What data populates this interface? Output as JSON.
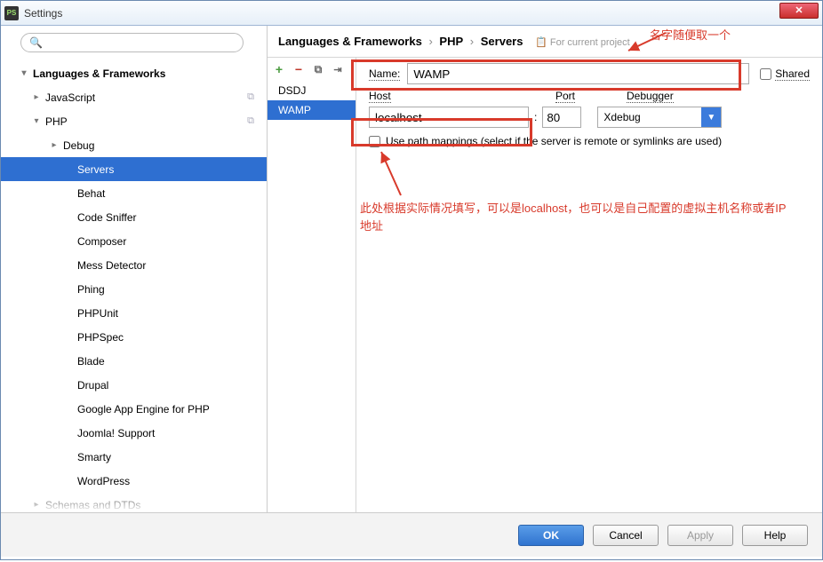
{
  "window": {
    "title": "Settings"
  },
  "search": {
    "placeholder": ""
  },
  "tree": {
    "root": "Languages & Frameworks",
    "items": [
      {
        "label": "JavaScript",
        "level": 1,
        "arrow": "▸",
        "copy": true
      },
      {
        "label": "PHP",
        "level": 1,
        "arrow": "▾",
        "copy": true
      },
      {
        "label": "Debug",
        "level": 2,
        "arrow": "▸"
      },
      {
        "label": "Servers",
        "level": 3,
        "selected": true
      },
      {
        "label": "Behat",
        "level": 3
      },
      {
        "label": "Code Sniffer",
        "level": 3
      },
      {
        "label": "Composer",
        "level": 3
      },
      {
        "label": "Mess Detector",
        "level": 3
      },
      {
        "label": "Phing",
        "level": 3
      },
      {
        "label": "PHPUnit",
        "level": 3
      },
      {
        "label": "PHPSpec",
        "level": 3
      },
      {
        "label": "Blade",
        "level": 3
      },
      {
        "label": "Drupal",
        "level": 3
      },
      {
        "label": "Google App Engine for PHP",
        "level": 3
      },
      {
        "label": "Joomla! Support",
        "level": 3
      },
      {
        "label": "Smarty",
        "level": 3
      },
      {
        "label": "WordPress",
        "level": 3
      }
    ],
    "cutoff": "Schemas and DTDs"
  },
  "breadcrumb": {
    "part1": "Languages & Frameworks",
    "part2": "PHP",
    "part3": "Servers",
    "scope": "For current project"
  },
  "servers": {
    "items": [
      "DSDJ",
      "WAMP"
    ],
    "selected": 1
  },
  "form": {
    "name_label": "Name:",
    "name_value": "WAMP",
    "shared_label": "Shared",
    "host_label": "Host",
    "port_label": "Port",
    "debugger_label": "Debugger",
    "host_value": "localhost",
    "port_value": "80",
    "debugger_value": "Xdebug",
    "path_mappings_label": "Use path mappings (select if the server is remote or symlinks are used)"
  },
  "buttons": {
    "ok": "OK",
    "cancel": "Cancel",
    "apply": "Apply",
    "help": "Help"
  },
  "annotations": {
    "top": "名字随便取一个",
    "body": "此处根据实际情况填写，可以是localhost，也可以是自己配置的虚拟主机名称或者IP地址"
  }
}
